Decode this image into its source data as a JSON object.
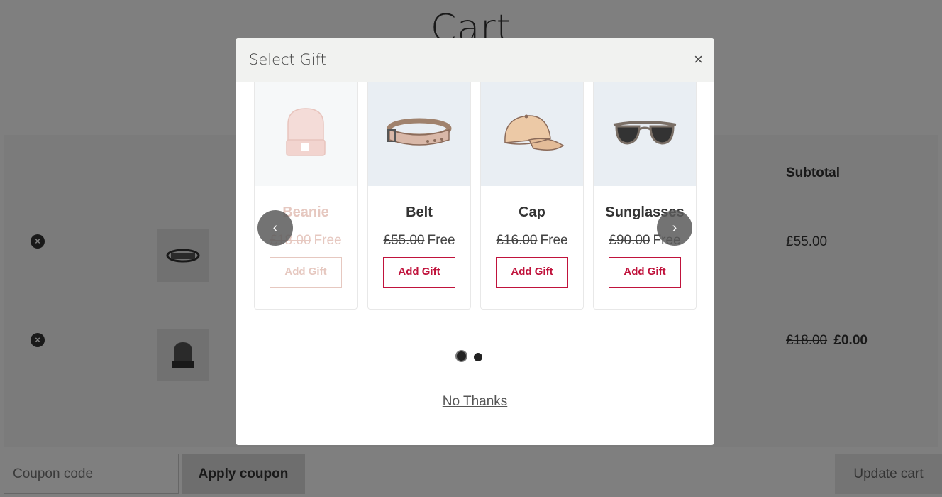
{
  "page": {
    "title": "Cart",
    "table_header_subtotal": "Subtotal",
    "rows": [
      {
        "remove": "×",
        "subtotal": "£55.00"
      },
      {
        "remove": "×",
        "subtotal_old": "£18.00",
        "subtotal": "£0.00"
      }
    ],
    "coupon_placeholder": "Coupon code",
    "apply_coupon": "Apply coupon",
    "update_cart": "Update cart"
  },
  "modal": {
    "title": "Select Gift",
    "close": "×",
    "prev": "‹",
    "next": "›",
    "gifts": [
      {
        "name": "Beanie",
        "old_price": "£18.00",
        "price": "Free",
        "button": "Add Gift",
        "icon": "beanie-icon"
      },
      {
        "name": "Belt",
        "old_price": "£55.00",
        "price": "Free",
        "button": "Add Gift",
        "icon": "belt-icon"
      },
      {
        "name": "Cap",
        "old_price": "£16.00",
        "price": "Free",
        "button": "Add Gift",
        "icon": "cap-icon"
      },
      {
        "name": "Sunglasses",
        "old_price": "£90.00",
        "price": "Free",
        "button": "Add Gift",
        "icon": "sunglasses-icon"
      }
    ],
    "pagination": {
      "pages": 2,
      "current": 1
    },
    "no_thanks": "No Thanks"
  },
  "colors": {
    "accent": "#c0133c",
    "overlay": "rgba(0,0,0,0.5)",
    "modal_header": "#f1f2f0"
  }
}
